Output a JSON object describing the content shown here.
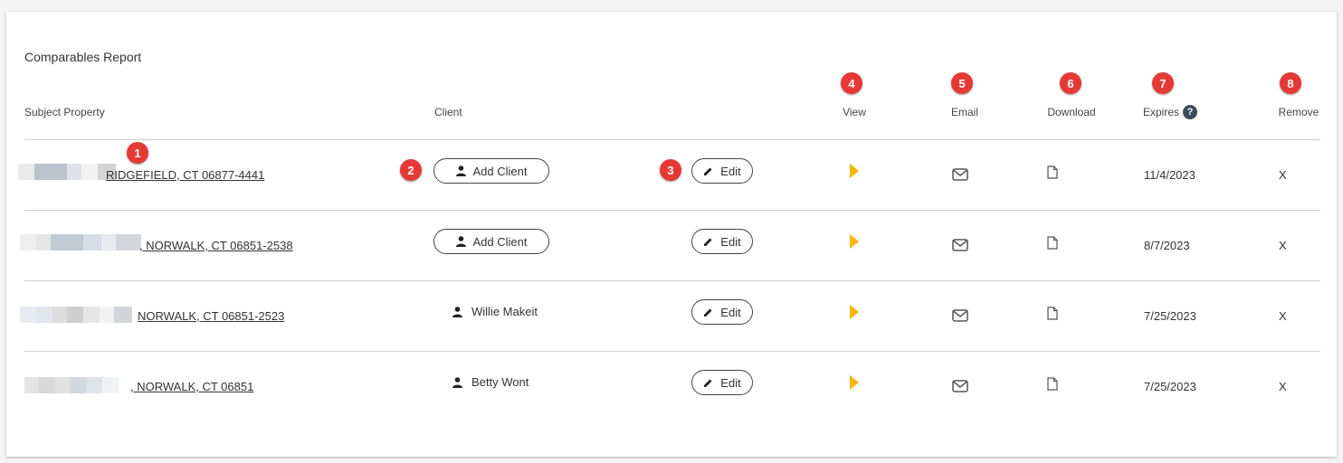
{
  "report": {
    "title": "Comparables Report"
  },
  "columns": {
    "subject_property": "Subject Property",
    "client": "Client",
    "view": "View",
    "email": "Email",
    "download": "Download",
    "expires": "Expires",
    "remove": "Remove"
  },
  "help_icon": "?",
  "badges": [
    "1",
    "2",
    "3",
    "4",
    "5",
    "6",
    "7",
    "8"
  ],
  "colors": {
    "accent_badge": "#e53935",
    "view_arrow": "#f5b800",
    "help_icon": "#3d4a5c"
  },
  "rows": [
    {
      "address": "RIDGEFIELD, CT 06877-4441",
      "client_button": "Add Client",
      "client_name": "",
      "edit": "Edit",
      "expires": "11/4/2023",
      "remove": "X"
    },
    {
      "address": ", NORWALK, CT 06851-2538",
      "client_button": "Add Client",
      "client_name": "",
      "edit": "Edit",
      "expires": "8/7/2023",
      "remove": "X"
    },
    {
      "address": "NORWALK, CT 06851-2523",
      "client_button": "",
      "client_name": "Willie Makeit",
      "edit": "Edit",
      "expires": "7/25/2023",
      "remove": "X"
    },
    {
      "address": ", NORWALK, CT 06851",
      "client_button": "",
      "client_name": "Betty Wont",
      "edit": "Edit",
      "expires": "7/25/2023",
      "remove": "X"
    }
  ]
}
